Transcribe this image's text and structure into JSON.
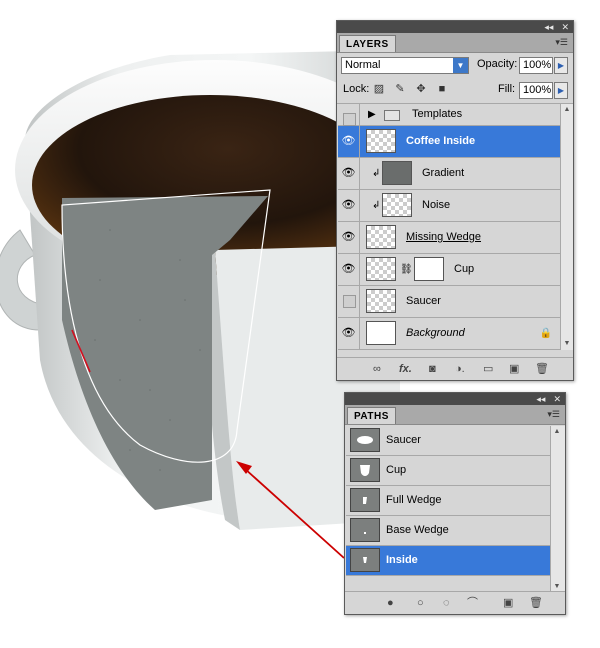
{
  "layers_panel": {
    "tab": "LAYERS",
    "title_buttons": [
      "◂◂",
      "✕"
    ],
    "blend_mode": "Normal",
    "opacity_label": "Opacity:",
    "opacity_value": "100%",
    "lock_label": "Lock:",
    "fill_label": "Fill:",
    "fill_value": "100%",
    "layers": [
      {
        "name": "Templates",
        "visible": false,
        "kind": "group"
      },
      {
        "name": "Coffee Inside",
        "visible": true,
        "selected": true
      },
      {
        "name": "Gradient",
        "visible": true,
        "clipped": true
      },
      {
        "name": "Noise",
        "visible": true,
        "clipped": true
      },
      {
        "name": "Missing Wedge",
        "visible": true
      },
      {
        "name": "Cup",
        "visible": true,
        "mask": true
      },
      {
        "name": "Saucer",
        "visible": false
      },
      {
        "name": "Background",
        "visible": true,
        "locked": true
      }
    ],
    "bottom_icons": [
      "link-icon",
      "fx-icon",
      "mask-icon",
      "adjustment-icon",
      "group-icon",
      "new-layer-icon",
      "trash-icon"
    ]
  },
  "paths_panel": {
    "tab": "PATHS",
    "title_buttons": [
      "◂◂",
      "✕"
    ],
    "paths": [
      {
        "name": "Saucer"
      },
      {
        "name": "Cup"
      },
      {
        "name": "Full Wedge"
      },
      {
        "name": "Base Wedge"
      },
      {
        "name": "Inside",
        "selected": true
      }
    ],
    "bottom_icons": [
      "fill-path-icon",
      "stroke-path-icon",
      "load-selection-icon",
      "make-path-icon",
      "new-path-icon",
      "trash-icon"
    ]
  },
  "colors": {
    "selection": "#3879d9",
    "panel_bg": "#d6d6d6",
    "annotation_arrow": "#cc0000"
  }
}
